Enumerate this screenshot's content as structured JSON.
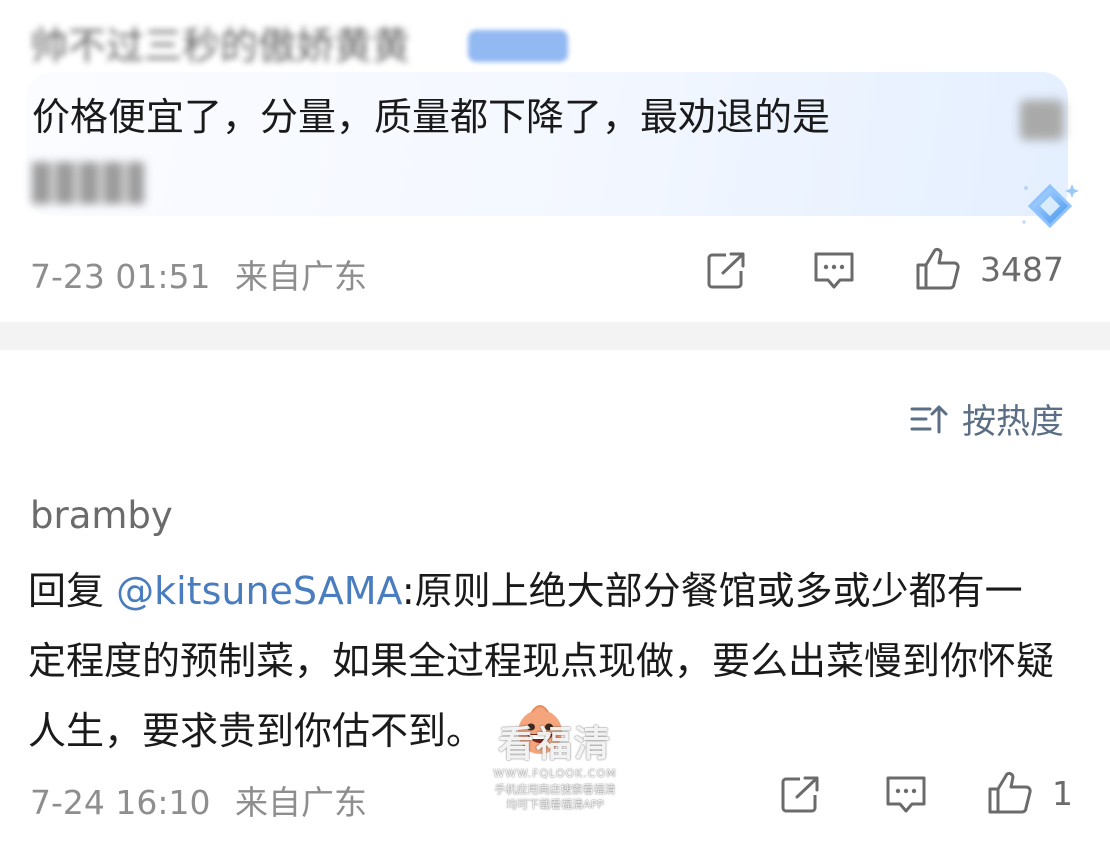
{
  "comment1": {
    "author": "帅不过三秒的傲娇黄黄",
    "text": "价格便宜了，分量，质量都下降了，最劝退的是",
    "time": "7-23 01:51",
    "location": "来自广东",
    "like_count": "3487"
  },
  "sort": {
    "label": "按热度"
  },
  "comment2": {
    "author": "bramby",
    "reply_prefix": "回复",
    "mention": "@kitsuneSAMA",
    "text": ":原则上绝大部分餐馆或多或少都有一定程度的预制菜，如果全过程现点现做，要么出菜慢到你怀疑人生，要求贵到你估不到。",
    "time": "7-24 16:10",
    "location": "来自广东",
    "like_count": "1"
  },
  "watermark": {
    "title": "看福清",
    "url": "WWW.FQLOOK.COM",
    "line1": "手机应用商店搜索看福清",
    "line2": "均可下载看福清APP"
  },
  "icons": {
    "share": "share-icon",
    "comment": "comment-icon",
    "like": "thumbs-up-icon",
    "sort": "sort-icon",
    "badge": "diamond-badge-icon",
    "emoji": "grinning-face-icon"
  },
  "colors": {
    "meta_text": "#8e8e8e",
    "mention": "#4a7dbf",
    "sort_text": "#5a6e86",
    "divider": "#f3f3f3"
  }
}
